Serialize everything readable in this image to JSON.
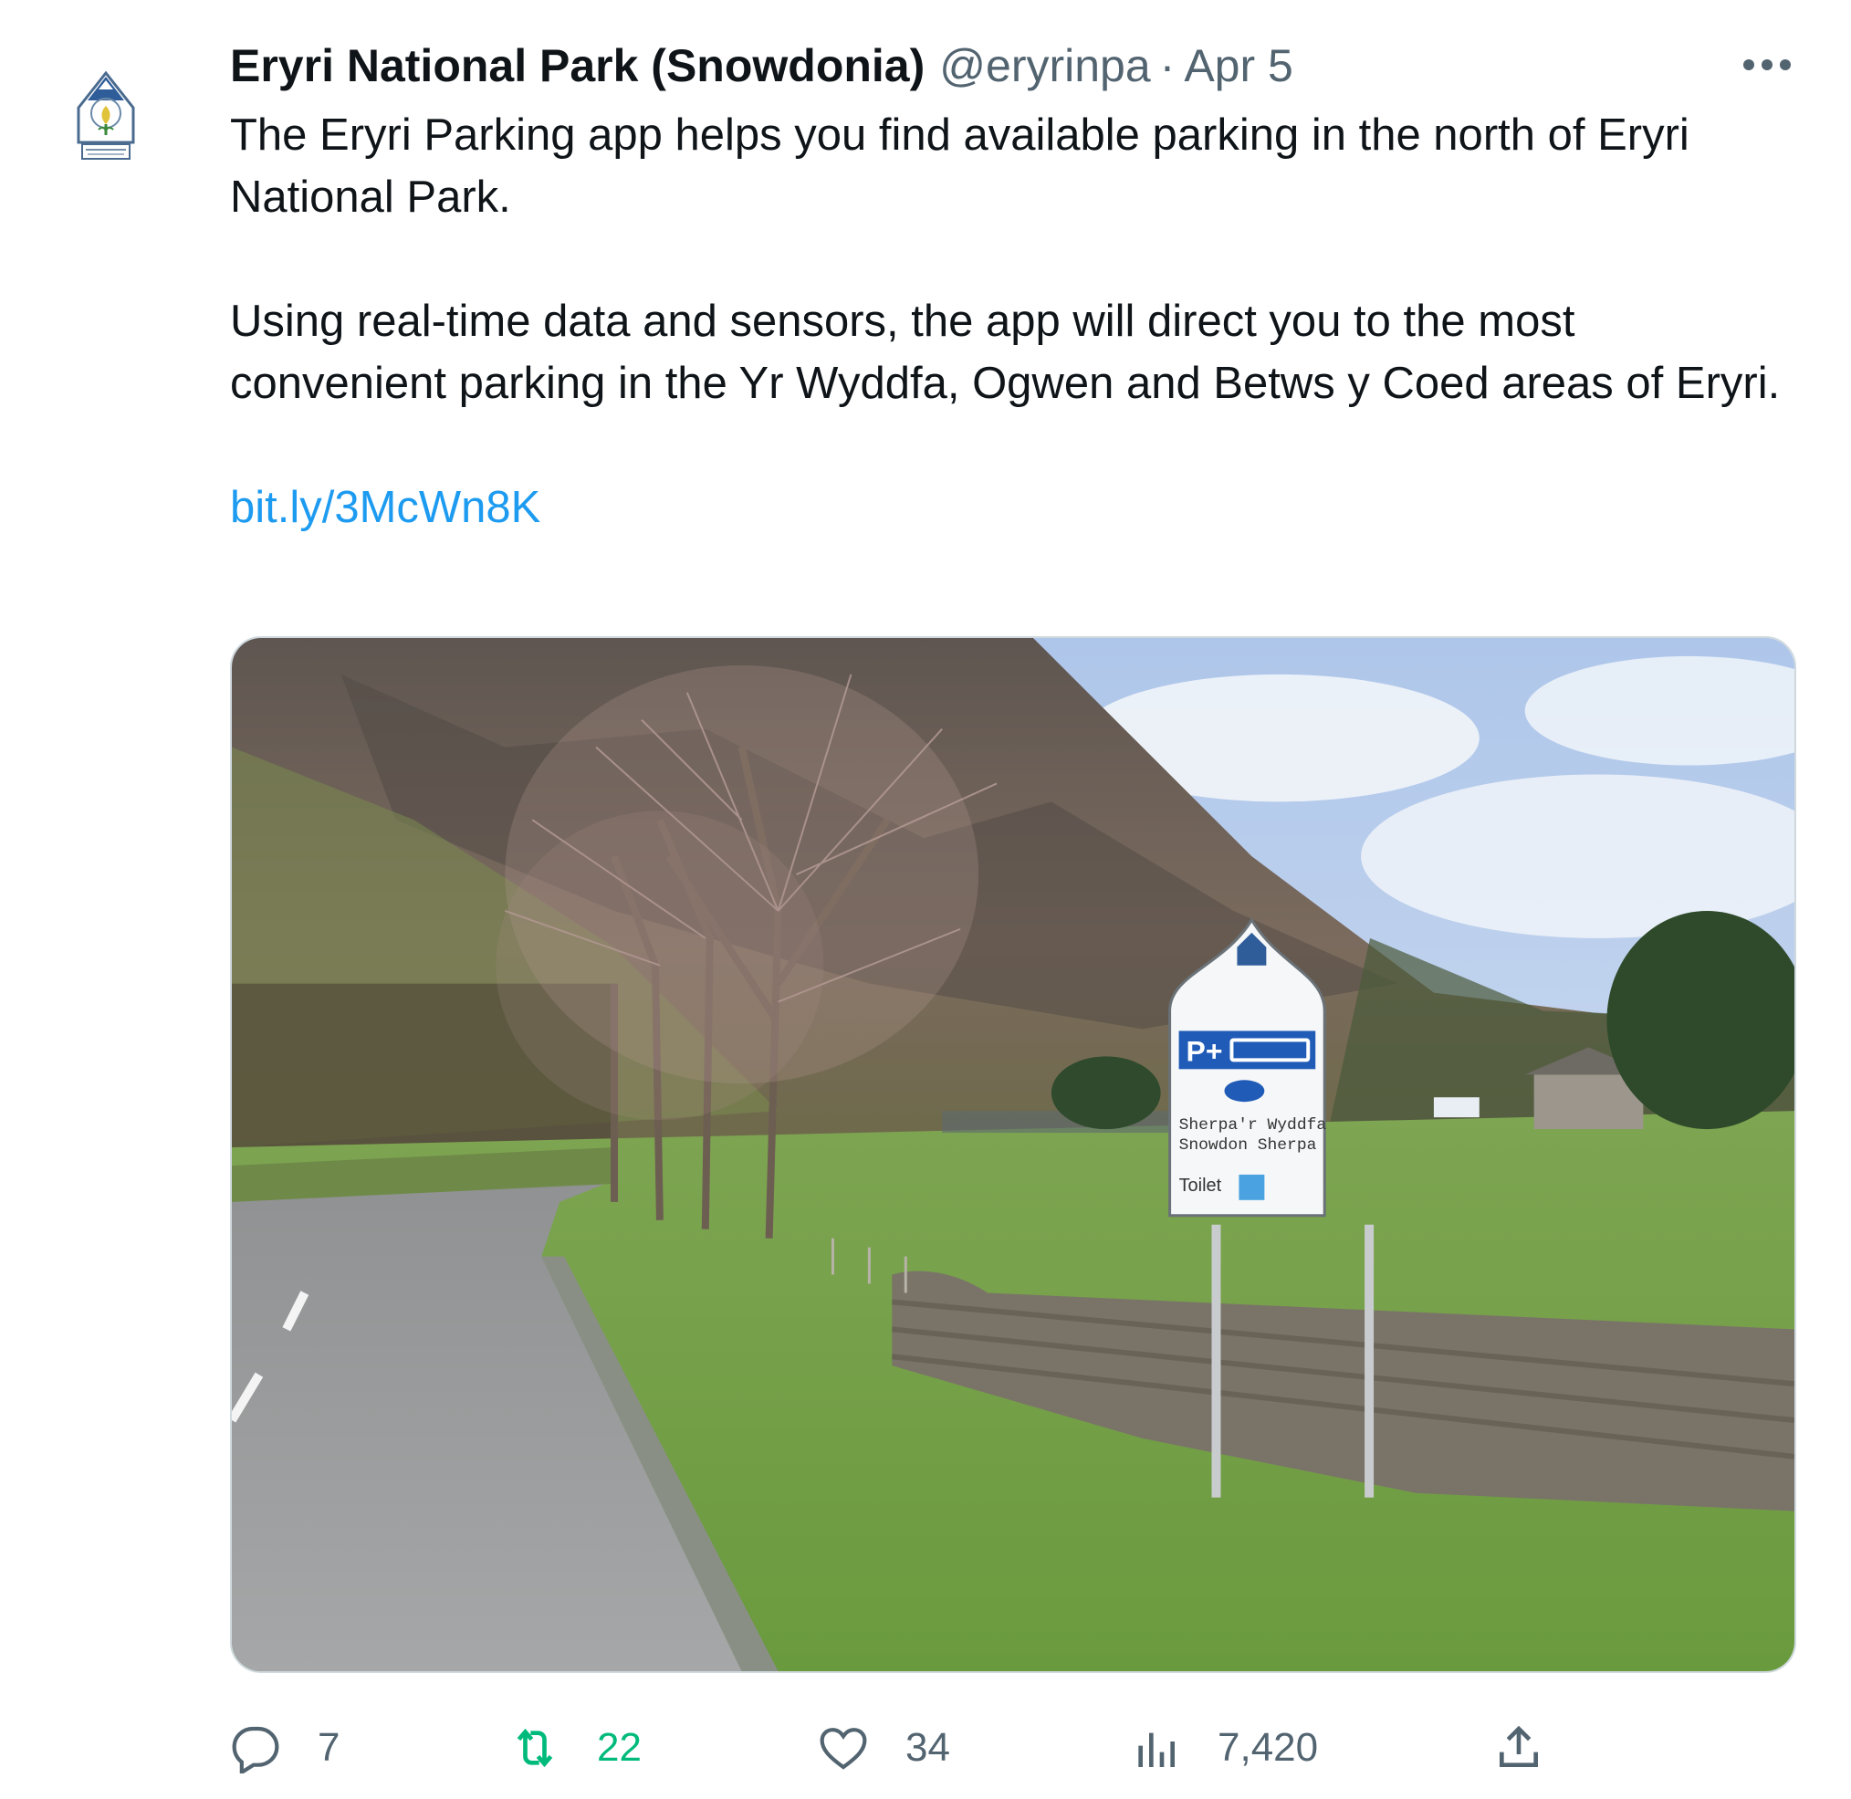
{
  "tweet": {
    "display_name": "Eryri National Park (Snowdonia)",
    "handle": "@eryrinpa",
    "separator": "·",
    "date": "Apr 5",
    "paragraphs": [
      "The Eryri Parking app helps you find available parking in the north of Eryri National Park.",
      "Using real-time data and sensors, the app will direct you to the most convenient parking in the Yr Wyddfa, Ogwen and Betws y Coed areas of Eryri."
    ],
    "link": "bit.ly/3McWn8K",
    "avatar_logo_text": [
      "PARC CENEDLAETHOL ERYRI",
      "SNOWDONIA",
      "NATIONAL PARK"
    ],
    "media": {
      "sign_lines": [
        "Sherpa'r Wyddfa",
        "Snowdon Sherpa"
      ],
      "sign_toilet": "Toilet",
      "sign_parking": "P+"
    },
    "actions": {
      "replies": "7",
      "retweets": "22",
      "likes": "34",
      "views": "7,420"
    },
    "icons": {
      "more": "more-horizontal-icon",
      "reply": "reply-icon",
      "retweet": "retweet-icon",
      "like": "heart-icon",
      "views": "views-icon",
      "share": "share-icon"
    },
    "colors": {
      "text": "#0f1419",
      "secondary": "#536471",
      "link": "#1d9bf0",
      "retweet": "#00ba7c"
    }
  }
}
